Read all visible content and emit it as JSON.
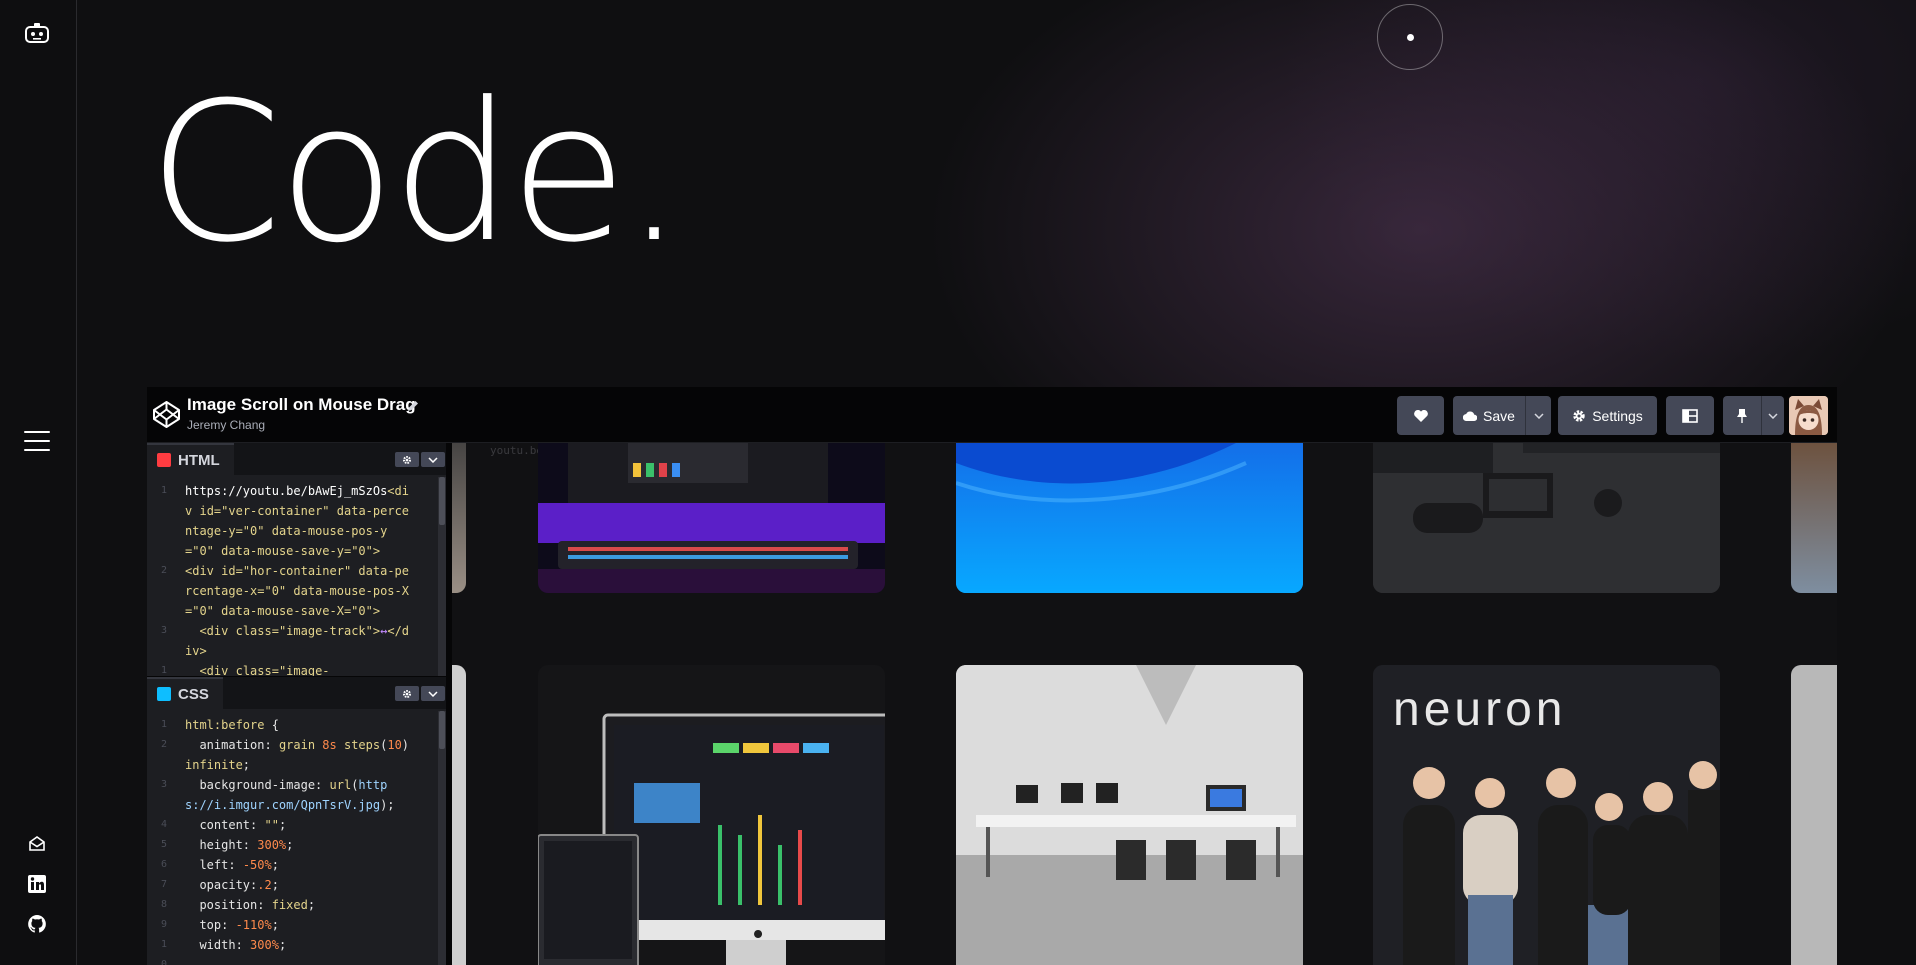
{
  "hero": {
    "title": "Code."
  },
  "rail": {
    "logo_icon": "robot-icon",
    "menu_icon": "hamburger-menu-icon",
    "social_icons": [
      "mail-icon",
      "linkedin-icon",
      "github-icon"
    ]
  },
  "pen": {
    "title": "Image Scroll on Mouse Drag",
    "author": "Jeremy Chang",
    "buttons": {
      "save": "Save",
      "settings": "Settings"
    }
  },
  "editors": {
    "html": {
      "label": "HTML",
      "badge_color": "#ff3c41",
      "lines": [
        {
          "n": "1",
          "text": "https://youtu.be/bAwEj_mSzOs<div id=\"ver-container\" data-percentage-y=\"0\" data-mouse-pos-y=\"0\" data-mouse-save-y=\"0\">"
        },
        {
          "n": "2",
          "text": "<div id=\"hor-container\" data-percentage-x=\"0\" data-mouse-pos-X=\"0\" data-mouse-save-X=\"0\">"
        },
        {
          "n": "3",
          "text": "  <div class=\"image-track\">↔</div>"
        },
        {
          "n": "12",
          "text": "  <div class=\"image-"
        }
      ]
    },
    "css": {
      "label": "CSS",
      "badge_color": "#0ebeff",
      "lines": [
        {
          "n": "1",
          "text": "html:before {"
        },
        {
          "n": "2",
          "text": "  animation: grain 8s steps(10) infinite;"
        },
        {
          "n": "3",
          "text": "  background-image: url(https://i.imgur.com/QpnTsrV.jpg);"
        },
        {
          "n": "4",
          "text": "  content: \"\";"
        },
        {
          "n": "5",
          "text": "  height: 300%;"
        },
        {
          "n": "6",
          "text": "  left: -50%;"
        },
        {
          "n": "7",
          "text": "  opacity:.2;"
        },
        {
          "n": "8",
          "text": "  position: fixed;"
        },
        {
          "n": "9",
          "text": "  top: -110%;"
        },
        {
          "n": "10",
          "text": "  width: 300%;"
        }
      ]
    }
  },
  "preview": {
    "faint_text": "youtu.be"
  },
  "colors": {
    "accent_button": "#444857",
    "header_bg": "#050506",
    "editor_bg": "#1d1e22"
  }
}
